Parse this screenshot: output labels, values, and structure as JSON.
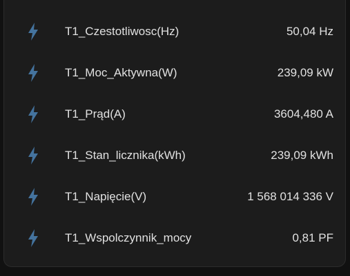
{
  "theme": {
    "card_background": "#1c1c1c",
    "page_background": "#111111",
    "icon_color": "#44739e",
    "text_color": "#e1e1e1"
  },
  "entities": [
    {
      "icon": "flash-icon",
      "name": "T1_Czestotliwosc(Hz)",
      "value": "50,04 Hz"
    },
    {
      "icon": "flash-icon",
      "name": "T1_Moc_Aktywna(W)",
      "value": "239,09 kW"
    },
    {
      "icon": "flash-icon",
      "name": "T1_Prąd(A)",
      "value": "3604,480 A"
    },
    {
      "icon": "flash-icon",
      "name": "T1_Stan_licznika(kWh)",
      "value": "239,09 kWh"
    },
    {
      "icon": "flash-icon",
      "name": "T1_Napięcie(V)",
      "value": "1 568 014 336 V"
    },
    {
      "icon": "flash-icon",
      "name": "T1_Wspolczynnik_mocy",
      "value": "0,81 PF"
    }
  ]
}
